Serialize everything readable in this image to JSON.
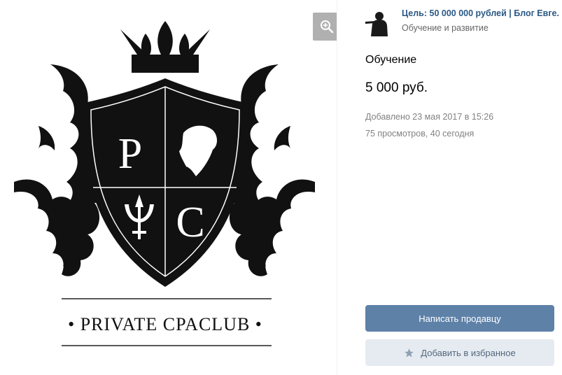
{
  "image": {
    "logo_text": "• PRIVATE CPACLUB •",
    "shield_letters": [
      "P",
      "C"
    ],
    "zoom_icon": "zoom-in-icon"
  },
  "seller": {
    "name": "Цель: 50 000 000 рублей | Блог Евге..",
    "category": "Обучение и развитие",
    "avatar_icon": "silhouette-avatar"
  },
  "item": {
    "title": "Обучение",
    "price": "5 000 руб.",
    "added": "Добавлено 23 мая 2017 в 15:26",
    "views": "75 просмотров, 40 сегодня"
  },
  "actions": {
    "contact_seller": "Написать продавцу",
    "add_favorite": "Добавить в избранное",
    "favorite_icon": "star-icon"
  },
  "colors": {
    "link": "#2a5885",
    "primary_button": "#5e81a8",
    "secondary_button": "#e5ebf1",
    "meta_text": "#828282"
  }
}
